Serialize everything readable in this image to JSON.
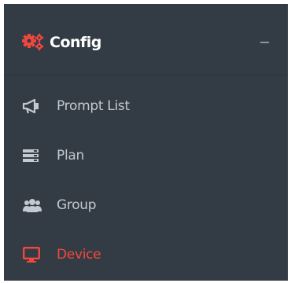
{
  "colors": {
    "background": "#333c44",
    "text": "#c3c9ce",
    "heading": "#ffffff",
    "accent": "#f2473f"
  },
  "section": {
    "title": "Config",
    "icon": "gears-icon",
    "collapse_symbol": "collapse-icon"
  },
  "menu": {
    "items": [
      {
        "label": "Prompt List",
        "icon": "megaphone-icon",
        "active": false
      },
      {
        "label": "Plan",
        "icon": "server-icon",
        "active": false
      },
      {
        "label": "Group",
        "icon": "users-icon",
        "active": false
      },
      {
        "label": "Device",
        "icon": "desktop-icon",
        "active": true
      }
    ]
  }
}
